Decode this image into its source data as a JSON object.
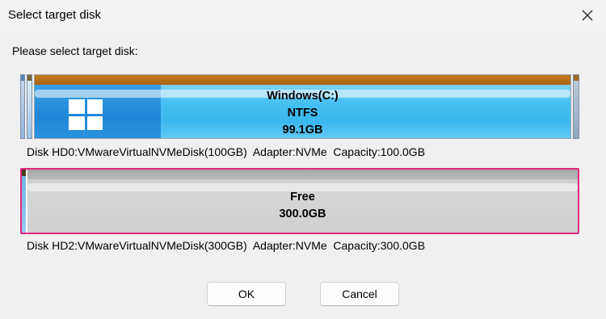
{
  "window": {
    "title": "Select target disk"
  },
  "prompt": "Please select target disk:",
  "disks": [
    {
      "partition": {
        "name": "Windows(C:)",
        "filesystem": "NTFS",
        "size": "99.1GB"
      },
      "info": "Disk HD0:VMwareVirtualNVMeDisk(100GB)  Adapter:NVMe  Capacity:100.0GB",
      "selected": false
    },
    {
      "partition": {
        "name": "Free",
        "size": "300.0GB"
      },
      "info": "Disk HD2:VMwareVirtualNVMeDisk(300GB)  Adapter:NVMe  Capacity:300.0GB",
      "selected": true
    }
  ],
  "buttons": {
    "ok": "OK",
    "cancel": "Cancel"
  },
  "icons": {
    "close": "close-icon",
    "windows": "windows-logo-icon"
  },
  "colors": {
    "selection_border": "#e0287d",
    "partition_fill": "#44c0f2",
    "partition_cap": "#c27a1e"
  }
}
